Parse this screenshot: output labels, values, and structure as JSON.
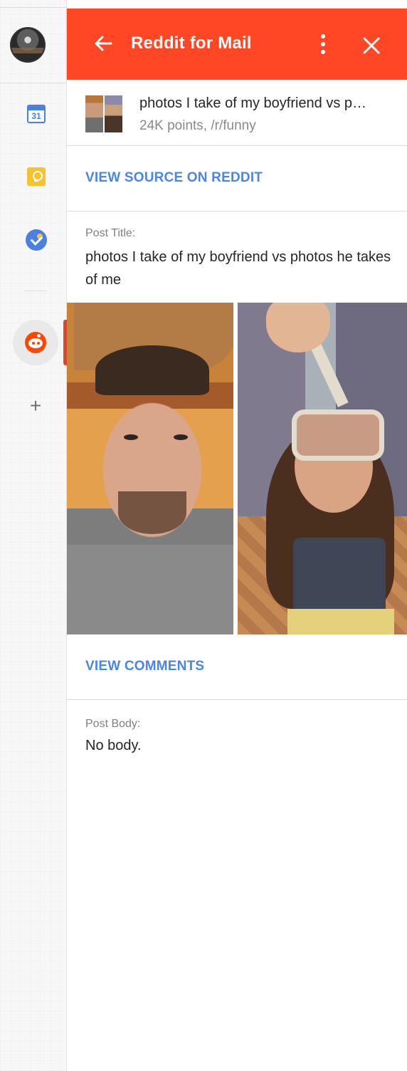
{
  "header": {
    "title": "Reddit for Mail",
    "icons": {
      "back": "arrow-left-icon",
      "more": "more-vert-icon",
      "close": "close-icon"
    }
  },
  "sidebar": {
    "calendar_day": "31",
    "icons": [
      "calendar-icon",
      "keep-icon",
      "tasks-icon",
      "reddit-icon",
      "plus-icon"
    ]
  },
  "post": {
    "title_short": "photos I take of my boyfriend vs p…",
    "meta": "24K points, /r/funny",
    "view_source_label": "VIEW SOURCE ON REDDIT",
    "title_label": "Post Title:",
    "title_full": "photos I take of my boyfriend vs photos he takes of me",
    "view_comments_label": "VIEW COMMENTS",
    "body_label": "Post Body:",
    "body_text": "No body."
  },
  "colors": {
    "accent": "#ff4625",
    "link": "#4a86e8",
    "reddit": "#ff4500"
  }
}
